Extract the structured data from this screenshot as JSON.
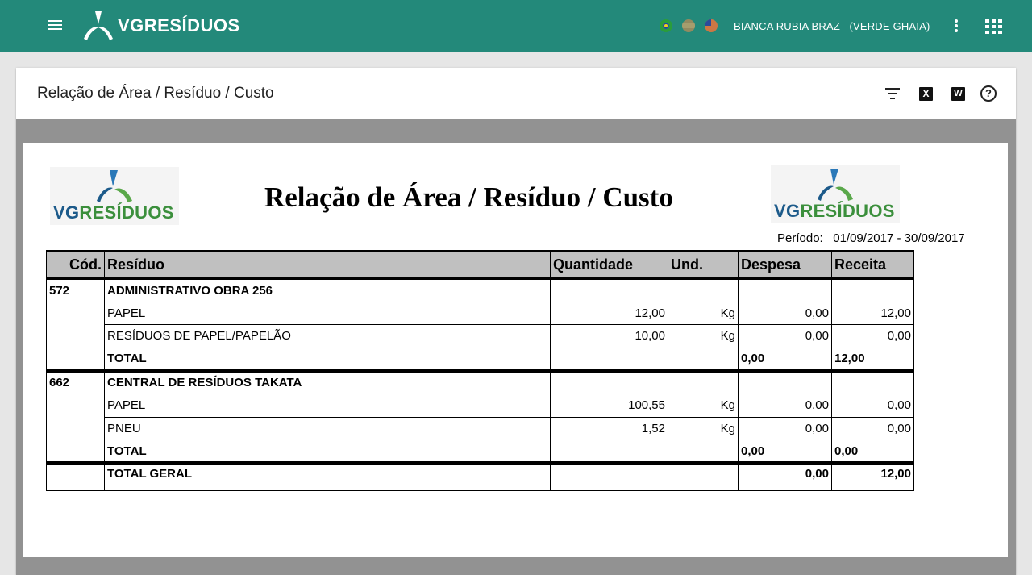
{
  "app": {
    "brand": "VGRESÍDUOS",
    "user": "BIANCA RUBIA BRAZ",
    "company": "(VERDE GHAIA)",
    "accent": "#23897a"
  },
  "icons": {
    "menu": "menu-icon",
    "flags": [
      "brazil-flag-icon",
      "spain-flag-icon",
      "usa-flag-icon"
    ],
    "more": "more-vert-icon",
    "apps": "apps-grid-icon",
    "filter": "filter-icon",
    "excel": "excel-icon",
    "word": "word-icon",
    "help": "help-icon"
  },
  "page": {
    "title": "Relação de Área / Resíduo / Custo",
    "export_excel_label": "X",
    "export_word_label": "W",
    "help_label": "?"
  },
  "report": {
    "title": "Relação de Área / Resíduo / Custo",
    "logo_vg": "VG",
    "logo_residuos": "RESÍDUOS",
    "periodo_label": "Período:",
    "periodo_value": "01/09/2017 - 30/09/2017",
    "columns": [
      "Cód.",
      "Resíduo",
      "Quantidade",
      "Und.",
      "Despesa",
      "Receita"
    ],
    "areas": [
      {
        "code": "572",
        "name": "ADMINISTRATIVO OBRA 256",
        "items": [
          {
            "residuo": "PAPEL",
            "quantidade": "12,00",
            "und": "Kg",
            "despesa": "0,00",
            "receita": "12,00"
          },
          {
            "residuo": "RESÍDUOS DE PAPEL/PAPELÃO",
            "quantidade": "10,00",
            "und": "Kg",
            "despesa": "0,00",
            "receita": "0,00"
          }
        ],
        "total_label": "TOTAL",
        "total_despesa": "0,00",
        "total_receita": "12,00"
      },
      {
        "code": "662",
        "name": "CENTRAL DE RESÍDUOS TAKATA",
        "items": [
          {
            "residuo": "PAPEL",
            "quantidade": "100,55",
            "und": "Kg",
            "despesa": "0,00",
            "receita": "0,00"
          },
          {
            "residuo": "PNEU",
            "quantidade": "1,52",
            "und": "Kg",
            "despesa": "0,00",
            "receita": "0,00"
          }
        ],
        "total_label": "TOTAL",
        "total_despesa": "0,00",
        "total_receita": "0,00"
      }
    ],
    "total_geral_label": "TOTAL GERAL",
    "total_geral_despesa": "0,00",
    "total_geral_receita": "12,00"
  }
}
